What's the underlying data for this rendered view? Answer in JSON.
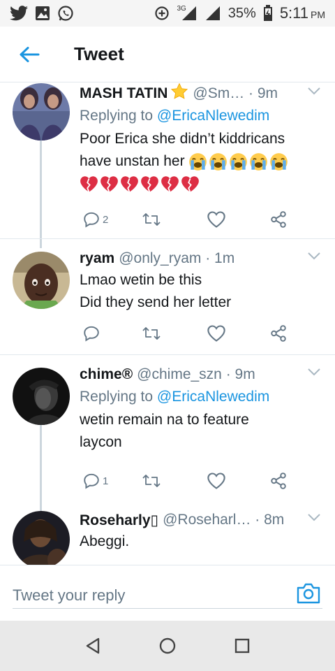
{
  "status_bar": {
    "left_icons": [
      "twitter-icon",
      "gallery-icon",
      "whatsapp-icon"
    ],
    "network": "3G",
    "battery": "35%",
    "time": "5:11",
    "ampm": "PM"
  },
  "header": {
    "title": "Tweet",
    "back_icon": "back-arrow-icon"
  },
  "tweets": [
    {
      "name": "MASH TATIN",
      "name_suffix": "⭐",
      "handle": "@Sm… · 9m",
      "reply_prefix": "Replying to ",
      "reply_to": "@EricaNlewedim",
      "text_line1": "Poor Erica she didn’t kiddricans",
      "text_line2": "have unstan her",
      "crying_emoji_count": 5,
      "broken_heart_count": 6,
      "reply_count": "2"
    },
    {
      "name": "ryam",
      "handle": "@only_ryam · 1m",
      "text_line1": "Lmao wetin be this",
      "text_line2": "Did they send her letter",
      "reply_count": ""
    },
    {
      "name": "chime®",
      "handle": "@chime_szn · 9m",
      "reply_prefix": "Replying to ",
      "reply_to": "@EricaNlewedim",
      "text_line1": "wetin remain na to feature",
      "text_line2": "laycon",
      "reply_count": "1"
    },
    {
      "name": "Roseharly▯",
      "handle": "@Roseharl… · 8m",
      "text_line1": "Abeggi."
    }
  ],
  "reply_bar": {
    "placeholder": "Tweet your reply"
  },
  "colors": {
    "accent": "#1b95e0",
    "text_primary": "#14171a",
    "text_secondary": "#657786",
    "divider": "#e1e8ed"
  }
}
